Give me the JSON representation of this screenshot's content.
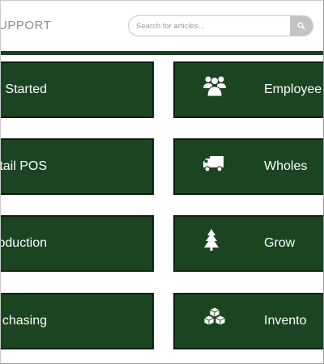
{
  "header": {
    "brand": "UPPORT",
    "search": {
      "placeholder": "Search for articles...",
      "value": ""
    }
  },
  "tiles_left": [
    {
      "label": "Started"
    },
    {
      "label": "tail POS"
    },
    {
      "label": "oduction"
    },
    {
      "label": "chasing"
    }
  ],
  "tiles_right": [
    {
      "label": "Employee",
      "icon": "users-icon"
    },
    {
      "label": "Wholes",
      "icon": "truck-icon"
    },
    {
      "label": "Grow",
      "icon": "tree-icon"
    },
    {
      "label": "Invento",
      "icon": "boxes-icon"
    }
  ],
  "colors": {
    "tile_background": "#1b4520",
    "tile_border": "#0d220f",
    "rule": "#1c3f1f",
    "search_button": "#c3c3c3"
  }
}
